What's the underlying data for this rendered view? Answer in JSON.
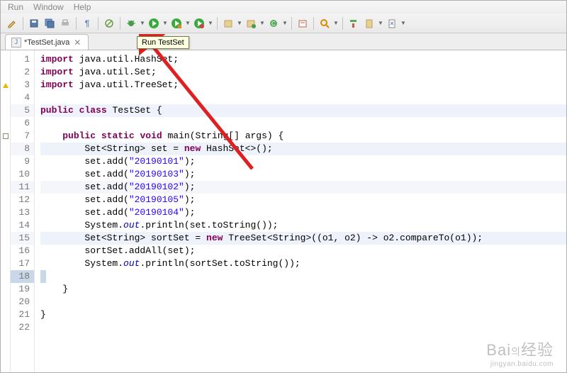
{
  "menu": {
    "items": [
      "Run",
      "Window",
      "Help"
    ]
  },
  "toolbar": {
    "tooltip": "Run TestSet",
    "buttons": {
      "edit": "edit",
      "save": "save",
      "saveall": "save-all",
      "print": "print",
      "pilcrow": "pilcrow",
      "step": "step",
      "debug": "debug",
      "run": "run",
      "runext": "run-ext",
      "runpkg": "run-pkg",
      "stop": "stop",
      "newfile": "new-file",
      "newpkg": "new-pkg",
      "search": "search",
      "cut": "cut",
      "paste": "paste",
      "link": "link"
    }
  },
  "tab": {
    "filename": "*TestSet.java"
  },
  "code": {
    "lines": [
      {
        "n": 1,
        "ann": "",
        "kind": "import",
        "text": "java.util.HashSet;"
      },
      {
        "n": 2,
        "ann": "",
        "kind": "import",
        "text": "java.util.Set;"
      },
      {
        "n": 3,
        "ann": "warn",
        "kind": "import",
        "text": "java.util.TreeSet;"
      },
      {
        "n": 4,
        "ann": "",
        "kind": "blank",
        "text": ""
      },
      {
        "n": 5,
        "ann": "",
        "kind": "class",
        "text": "TestSet {"
      },
      {
        "n": 6,
        "ann": "",
        "kind": "blank",
        "text": ""
      },
      {
        "n": 7,
        "ann": "ovr",
        "kind": "method",
        "text": "main(String[] args) {"
      },
      {
        "n": 8,
        "ann": "",
        "kind": "decl",
        "text": "Set<String> set = new HashSet<>();"
      },
      {
        "n": 9,
        "ann": "",
        "kind": "call",
        "text": "set.add(\"20190101\");"
      },
      {
        "n": 10,
        "ann": "",
        "kind": "call",
        "text": "set.add(\"20190103\");"
      },
      {
        "n": 11,
        "ann": "",
        "kind": "call",
        "text": "set.add(\"20190102\");"
      },
      {
        "n": 12,
        "ann": "",
        "kind": "call",
        "text": "set.add(\"20190105\");"
      },
      {
        "n": 13,
        "ann": "",
        "kind": "call",
        "text": "set.add(\"20190104\");"
      },
      {
        "n": 14,
        "ann": "",
        "kind": "out",
        "text": "System.out.println(set.toString());"
      },
      {
        "n": 15,
        "ann": "",
        "kind": "decl2",
        "text": "Set<String> sortSet = new TreeSet<String>((o1, o2) -> o2.compareTo(o1));"
      },
      {
        "n": 16,
        "ann": "",
        "kind": "plain",
        "text": "sortSet.addAll(set);"
      },
      {
        "n": 17,
        "ann": "",
        "kind": "out",
        "text": "System.out.println(sortSet.toString());"
      },
      {
        "n": 18,
        "ann": "",
        "kind": "caret",
        "text": ""
      },
      {
        "n": 19,
        "ann": "",
        "kind": "close",
        "text": "    }"
      },
      {
        "n": 20,
        "ann": "",
        "kind": "blank",
        "text": ""
      },
      {
        "n": 21,
        "ann": "",
        "kind": "close2",
        "text": "}"
      },
      {
        "n": 22,
        "ann": "",
        "kind": "blank",
        "text": ""
      }
    ],
    "strings": [
      "20190101",
      "20190103",
      "20190102",
      "20190105",
      "20190104"
    ]
  },
  "watermark": {
    "brand": "Bai",
    "brand2": "经验",
    "sub": "jingyan.baidu.com"
  }
}
